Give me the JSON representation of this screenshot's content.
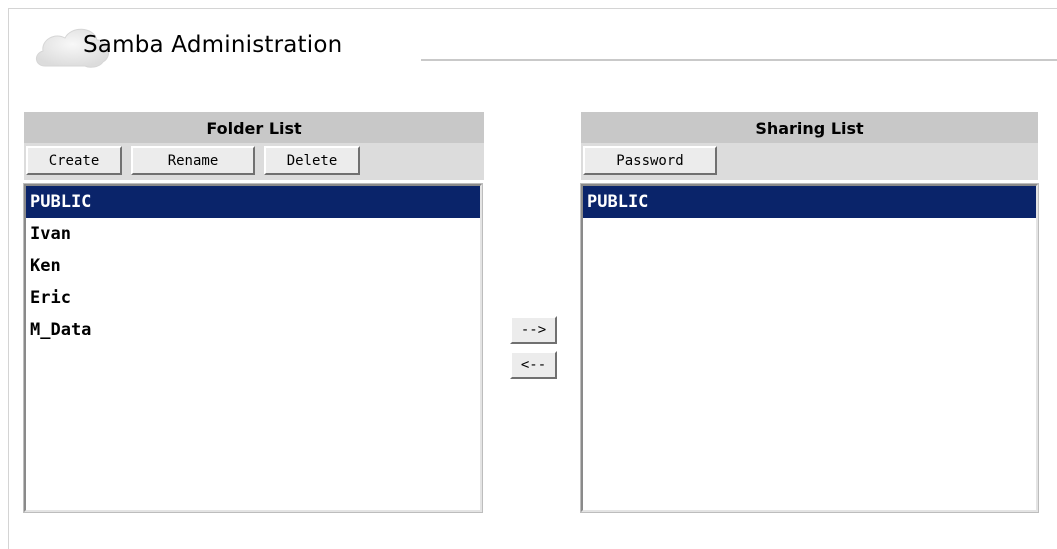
{
  "page": {
    "title": "Samba Administration"
  },
  "folder_panel": {
    "heading": "Folder List",
    "buttons": {
      "create": "Create",
      "rename": "Rename",
      "delete": "Delete"
    },
    "items": [
      "PUBLIC",
      "Ivan",
      "Ken",
      "Eric",
      "M_Data"
    ],
    "selected": "PUBLIC"
  },
  "transfer": {
    "add_label": "-->",
    "remove_label": "<--"
  },
  "sharing_panel": {
    "heading": "Sharing List",
    "buttons": {
      "password": "Password"
    },
    "items": [
      "PUBLIC"
    ],
    "selected": "PUBLIC"
  }
}
